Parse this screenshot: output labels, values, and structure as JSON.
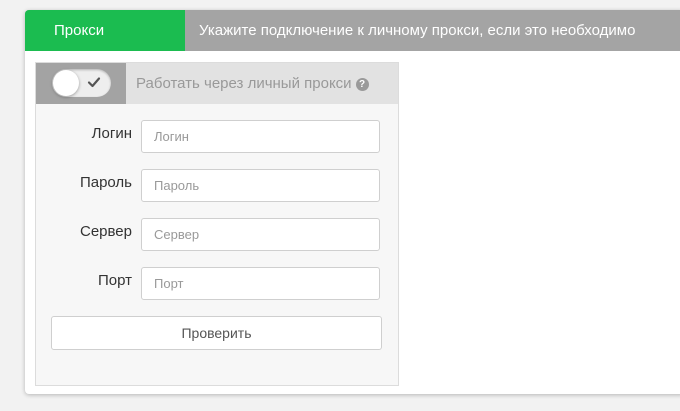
{
  "header": {
    "tab_label": "Прокси",
    "description": "Укажите подключение к личному прокси, если это необходимо"
  },
  "proxy": {
    "toggle_label": "Работать через личный прокси",
    "toggle_on": true,
    "help_symbol": "?"
  },
  "fields": [
    {
      "label": "Логин",
      "placeholder": "Логин",
      "value": ""
    },
    {
      "label": "Пароль",
      "placeholder": "Пароль",
      "value": ""
    },
    {
      "label": "Сервер",
      "placeholder": "Сервер",
      "value": ""
    },
    {
      "label": "Порт",
      "placeholder": "Порт",
      "value": ""
    }
  ],
  "check_button_label": "Проверить",
  "colors": {
    "tab_green": "#1bbc50",
    "header_gray": "#a4a4a4",
    "toggle_gray": "#a3a3a3"
  },
  "icons": {
    "switch_check": "check-icon",
    "help": "help-icon"
  }
}
